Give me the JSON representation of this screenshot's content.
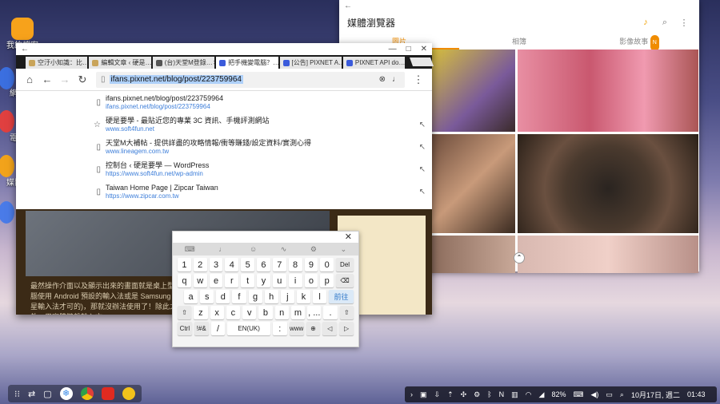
{
  "desktop": {
    "icons": [
      {
        "label": "我的檔案",
        "color": "#f7a21b"
      },
      {
        "label": "網",
        "color": "#3b6fe0"
      },
      {
        "label": "電",
        "color": "#e04040"
      },
      {
        "label": "媒體",
        "color": "#f2a31b"
      },
      {
        "label": "",
        "color": "#4a7be8"
      }
    ]
  },
  "media": {
    "title": "媒體瀏覽器",
    "tabs": [
      "圖片",
      "相簿",
      "影像故事"
    ],
    "badge": "N",
    "back": "←"
  },
  "chrome": {
    "tabs": [
      {
        "label": "空汙小知識：比…",
        "color": "#c9a45a"
      },
      {
        "label": "編輯文章 ‹ 硬是…",
        "color": "#c9a45a"
      },
      {
        "label": "(台)天堂M登錄…",
        "color": "#555555"
      },
      {
        "label": "把手機變電腦？…",
        "color": "#3b5bdb",
        "active": true
      },
      {
        "label": "[公告] PIXNET A…",
        "color": "#3b5bdb"
      },
      {
        "label": "PIXNET API do…",
        "color": "#3b5bdb"
      }
    ],
    "url": "ifans.pixnet.net/blog/post/223759964",
    "suggestions": [
      {
        "title": "ifans.pixnet.net/blog/post/223759964",
        "url": "ifans.pixnet.net/blog/post/223759964",
        "icon": "page-icon"
      },
      {
        "title": "硬是要學 - 最貼近您的專業 3C 資訊、手機評測網站",
        "url": "www.soft4fun.net",
        "icon": "star-icon"
      },
      {
        "title": "天堂M大補帖 - 提供詳盡的攻略情報/衝等賺錢/設定資料/實測心得",
        "url": "www.lineagem.com.tw",
        "icon": "page-icon"
      },
      {
        "title": "控制台 ‹ 硬是要學 — WordPress",
        "url": "https://www.soft4fun.net/wp-admin",
        "icon": "page-icon"
      },
      {
        "title": "Taiwan Home Page | Zipcar Taiwan",
        "url": "https://www.zipcar.com.tw",
        "icon": "page-icon"
      }
    ],
    "page_text": "最然操作介面以及顯示出來的畫面就是桌上型電腦使用 Android 預設的輸入法或是 Samsung 三星輸入法才可的)，那就沒辦法使用了！除此之外，用實體鍵盤輸入文"
  },
  "keyboard": {
    "close": "✕",
    "row1": [
      "1",
      "2",
      "3",
      "4",
      "5",
      "6",
      "7",
      "8",
      "9",
      "0",
      "Del"
    ],
    "row2": [
      "q",
      "w",
      "e",
      "r",
      "t",
      "y",
      "u",
      "i",
      "o",
      "p",
      "⌫"
    ],
    "row3": [
      "a",
      "s",
      "d",
      "f",
      "g",
      "h",
      "j",
      "k",
      "l",
      "前往"
    ],
    "row4": [
      "⇧",
      "z",
      "x",
      "c",
      "v",
      "b",
      "n",
      "m",
      ", ...",
      ".",
      "⇧"
    ],
    "row5": [
      "Ctrl",
      "!#&",
      "/",
      "EN(UK)",
      ":",
      "www",
      "⊕",
      "◁",
      "▷"
    ]
  },
  "tray": {
    "battery": "82%",
    "date": "10月17日, 週二",
    "time": "01:43"
  }
}
